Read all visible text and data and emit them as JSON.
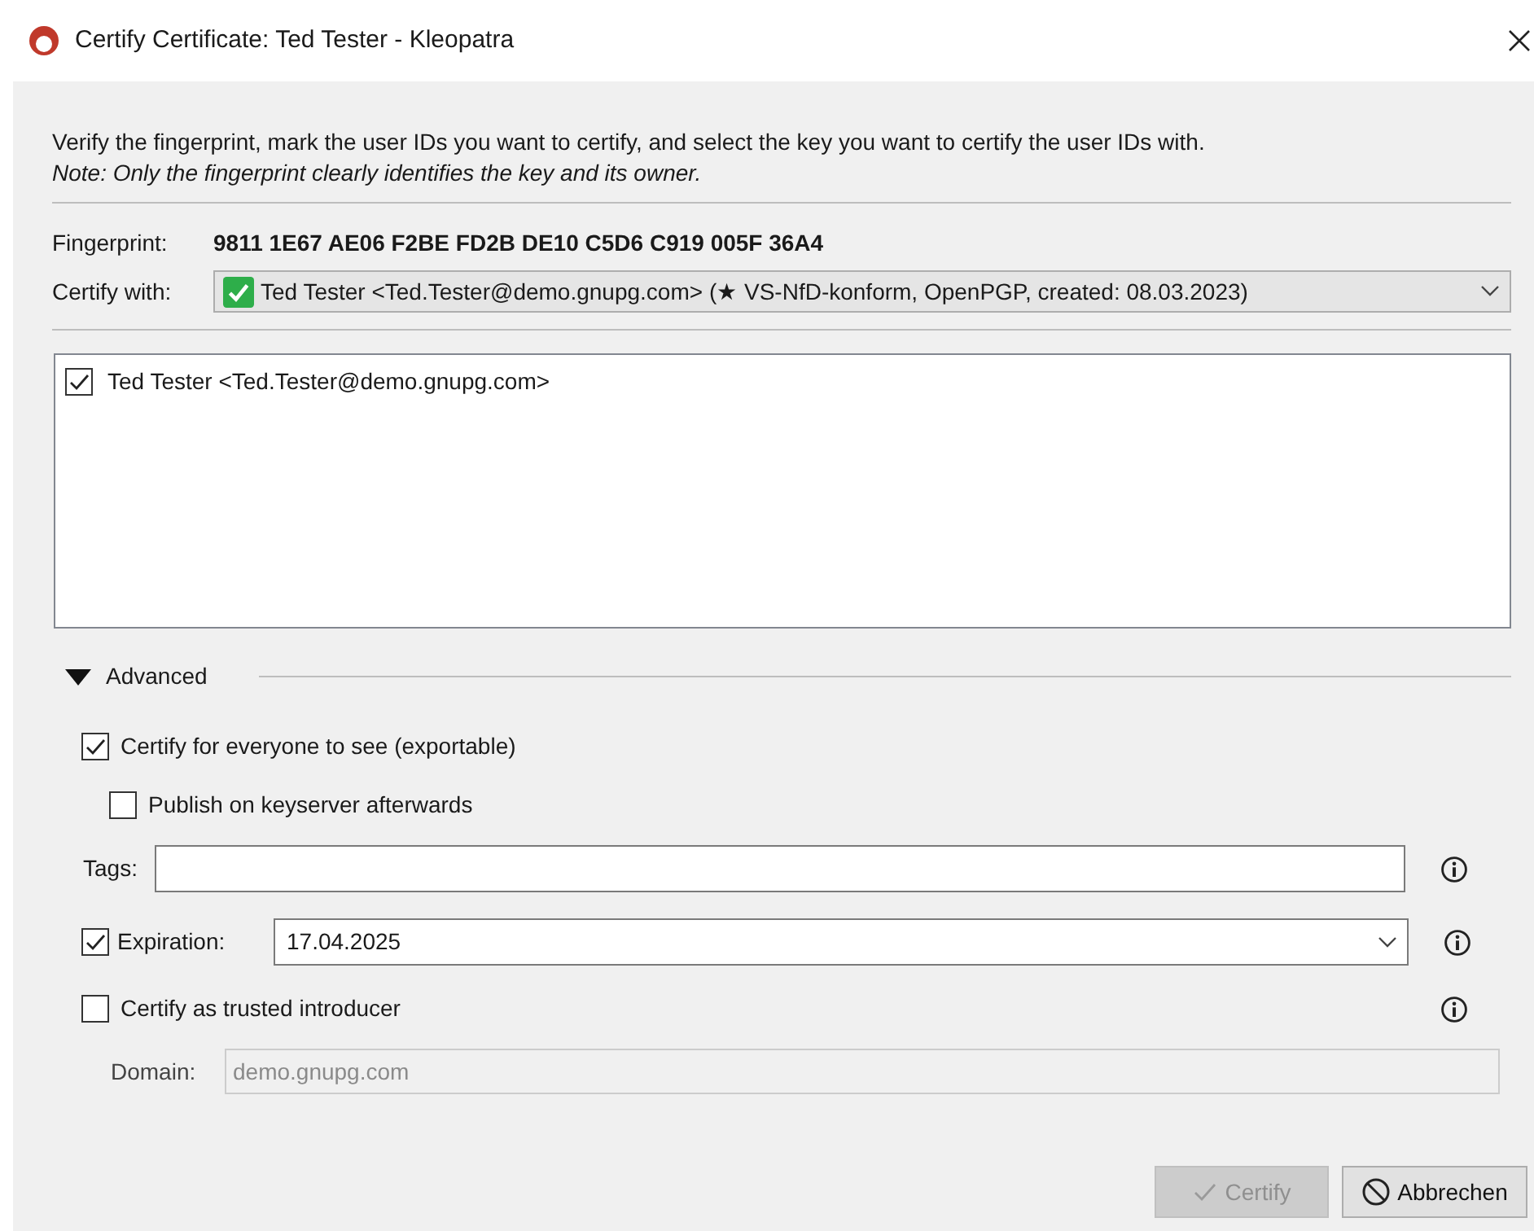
{
  "window": {
    "title": "Certify Certificate: Ted Tester - Kleopatra"
  },
  "intro": "Verify the fingerprint, mark the user IDs you want to certify, and select the key you want to certify the user IDs with.",
  "note": "Note: Only the fingerprint clearly identifies the key and its owner.",
  "fingerprint": {
    "label": "Fingerprint:",
    "value": "9811 1E67 AE06 F2BE FD2B DE10 C5D6 C919 005F 36A4"
  },
  "certify_with": {
    "label": "Certify with:",
    "value": "Ted Tester <Ted.Tester@demo.gnupg.com> (★ VS-NfD-konform, OpenPGP, created: 08.03.2023)"
  },
  "user_ids": [
    {
      "label": "Ted Tester <Ted.Tester@demo.gnupg.com>",
      "checked": true
    }
  ],
  "advanced": {
    "label": "Advanced",
    "expanded": true
  },
  "exportable": {
    "label": "Certify for everyone to see (exportable)",
    "checked": true
  },
  "publish": {
    "label": "Publish on keyserver afterwards",
    "checked": false
  },
  "tags": {
    "label": "Tags:"
  },
  "expiration": {
    "label": "Expiration:",
    "checked": true,
    "value": "17.04.2025"
  },
  "trusted_introducer": {
    "label": "Certify as trusted introducer",
    "checked": false
  },
  "domain": {
    "label": "Domain:",
    "value": "demo.gnupg.com",
    "disabled": true
  },
  "buttons": [
    {
      "kind": "certify",
      "label": "Certify",
      "disabled": true
    },
    {
      "kind": "cancel",
      "label": "Abbrechen",
      "disabled": false
    }
  ]
}
